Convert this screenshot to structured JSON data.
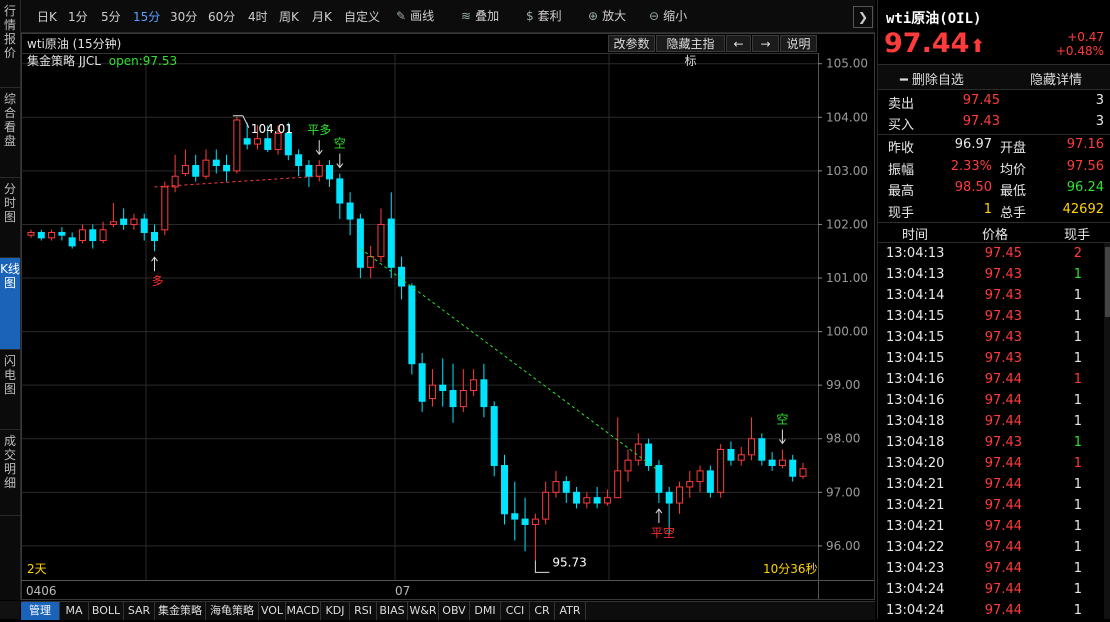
{
  "left_tabs": [
    {
      "label": "行情报价",
      "active": false
    },
    {
      "label": "综合看盘",
      "active": false
    },
    {
      "label": "分时图",
      "active": false
    },
    {
      "label": "K线图",
      "active": true
    },
    {
      "label": "闪电图",
      "active": false
    },
    {
      "label": "成交明细",
      "active": false
    }
  ],
  "toolbar": {
    "periods": [
      "日K",
      "1分",
      "5分",
      "15分",
      "30分",
      "60分",
      "4时",
      "周K",
      "月K",
      "自定义"
    ],
    "selected_period": "15分",
    "tools": [
      {
        "label": "画线",
        "icon": "pencil-icon"
      },
      {
        "label": "叠加",
        "icon": "stack-icon"
      },
      {
        "label": "套利",
        "icon": "money-bag-icon"
      },
      {
        "label": "放大",
        "icon": "zoom-in-icon"
      },
      {
        "label": "缩小",
        "icon": "zoom-out-icon"
      }
    ]
  },
  "chart": {
    "title": "wti原油 (15分钟)",
    "strategy_label": "集金策略 JJCL",
    "open_label": "open:97.53",
    "buttons": [
      "改参数",
      "隐藏主指标",
      "←",
      "→",
      "说明"
    ],
    "period_span": "2天",
    "countdown": "10分36秒",
    "date_labels": [
      "0406",
      "07"
    ],
    "hi_label": "104.01",
    "lo_label": "95.73",
    "signals": [
      {
        "text": "多",
        "color": "#ff2a2a",
        "idx": 12,
        "pos": "below"
      },
      {
        "text": "平多",
        "color": "#2fe12f",
        "idx": 28,
        "pos": "above"
      },
      {
        "text": "空",
        "color": "#2fe12f",
        "idx": 30,
        "pos": "above"
      },
      {
        "text": "平空",
        "color": "#ff2a2a",
        "idx": 61,
        "pos": "below"
      },
      {
        "text": "空",
        "color": "#2fe12f",
        "idx": 73,
        "pos": "above"
      }
    ],
    "colors": {
      "up": "#ff3b3b",
      "down": "#00e5ff",
      "text_green": "#2fe12f",
      "axis": "#9a9a9a"
    }
  },
  "chart_data": {
    "type": "candlestick",
    "y_ticks": [
      "105.00",
      "104.00",
      "103.00",
      "102.00",
      "101.00",
      "100.00",
      "99.00",
      "98.00",
      "97.00",
      "96.00"
    ],
    "ylim": [
      95.55,
      105.2
    ],
    "candles": [
      [
        101.8,
        101.85,
        101.75,
        101.9
      ],
      [
        101.85,
        101.75,
        101.7,
        101.9
      ],
      [
        101.75,
        101.85,
        101.7,
        101.9
      ],
      [
        101.85,
        101.8,
        101.7,
        101.95
      ],
      [
        101.75,
        101.6,
        101.55,
        101.85
      ],
      [
        101.7,
        101.9,
        101.65,
        102.0
      ],
      [
        101.9,
        101.7,
        101.55,
        102.0
      ],
      [
        101.7,
        101.9,
        101.65,
        102.05
      ],
      [
        102.0,
        102.05,
        101.95,
        102.4
      ],
      [
        102.1,
        102.0,
        101.9,
        102.3
      ],
      [
        102.0,
        102.1,
        101.9,
        102.2
      ],
      [
        102.1,
        101.85,
        101.7,
        102.2
      ],
      [
        101.85,
        101.7,
        101.5,
        102.0
      ],
      [
        101.9,
        102.7,
        101.8,
        102.8
      ],
      [
        102.7,
        102.9,
        102.6,
        103.3
      ],
      [
        102.95,
        103.1,
        102.9,
        103.4
      ],
      [
        103.1,
        102.9,
        102.8,
        103.3
      ],
      [
        102.9,
        103.2,
        102.85,
        103.4
      ],
      [
        103.2,
        103.1,
        102.95,
        103.4
      ],
      [
        103.1,
        103.0,
        102.8,
        103.3
      ],
      [
        103.0,
        103.95,
        102.95,
        104.01
      ],
      [
        103.6,
        103.5,
        103.4,
        103.9
      ],
      [
        103.5,
        103.6,
        103.4,
        103.85
      ],
      [
        103.6,
        103.4,
        103.35,
        103.85
      ],
      [
        103.4,
        103.7,
        103.3,
        103.85
      ],
      [
        103.7,
        103.3,
        103.2,
        103.9
      ],
      [
        103.3,
        103.1,
        102.9,
        103.4
      ],
      [
        103.1,
        102.9,
        102.7,
        103.2
      ],
      [
        102.9,
        103.1,
        102.8,
        103.2
      ],
      [
        103.1,
        102.85,
        102.7,
        103.2
      ],
      [
        102.85,
        102.4,
        102.1,
        102.95
      ],
      [
        102.4,
        102.1,
        101.8,
        102.6
      ],
      [
        102.1,
        101.2,
        101.0,
        102.2
      ],
      [
        101.2,
        101.4,
        101.0,
        101.6
      ],
      [
        101.4,
        102.0,
        101.3,
        102.3
      ],
      [
        102.1,
        101.2,
        101.0,
        102.6
      ],
      [
        101.2,
        100.85,
        100.6,
        101.4
      ],
      [
        100.85,
        99.4,
        99.2,
        100.9
      ],
      [
        99.4,
        98.7,
        98.5,
        99.6
      ],
      [
        98.75,
        99.0,
        98.6,
        99.3
      ],
      [
        99.0,
        98.9,
        98.6,
        99.5
      ],
      [
        98.9,
        98.6,
        98.3,
        99.4
      ],
      [
        98.6,
        98.9,
        98.5,
        99.3
      ],
      [
        98.9,
        99.1,
        98.8,
        99.3
      ],
      [
        99.1,
        98.6,
        98.4,
        99.4
      ],
      [
        98.6,
        97.5,
        97.3,
        98.7
      ],
      [
        97.5,
        96.6,
        96.4,
        97.7
      ],
      [
        96.6,
        96.5,
        96.1,
        97.2
      ],
      [
        96.5,
        96.4,
        95.9,
        96.9
      ],
      [
        96.4,
        96.5,
        95.73,
        96.6
      ],
      [
        96.5,
        97.0,
        96.4,
        97.2
      ],
      [
        97.0,
        97.2,
        96.9,
        97.4
      ],
      [
        97.2,
        97.0,
        96.8,
        97.3
      ],
      [
        97.0,
        96.8,
        96.7,
        97.1
      ],
      [
        96.8,
        96.9,
        96.7,
        97.0
      ],
      [
        96.9,
        96.8,
        96.7,
        97.1
      ],
      [
        96.8,
        96.9,
        96.75,
        97.05
      ],
      [
        96.9,
        97.4,
        96.9,
        98.4
      ],
      [
        97.4,
        97.6,
        97.2,
        97.8
      ],
      [
        97.6,
        97.9,
        97.5,
        98.1
      ],
      [
        97.9,
        97.5,
        97.4,
        98.0
      ],
      [
        97.5,
        97.0,
        96.8,
        97.6
      ],
      [
        97.0,
        96.8,
        96.2,
        97.1
      ],
      [
        96.8,
        97.1,
        96.6,
        97.2
      ],
      [
        97.1,
        97.2,
        96.9,
        97.4
      ],
      [
        97.2,
        97.4,
        97.0,
        97.5
      ],
      [
        97.4,
        97.0,
        96.9,
        97.5
      ],
      [
        97.0,
        97.8,
        96.9,
        97.9
      ],
      [
        97.8,
        97.6,
        97.5,
        97.95
      ],
      [
        97.6,
        97.7,
        97.5,
        97.85
      ],
      [
        97.7,
        98.0,
        97.6,
        98.4
      ],
      [
        98.0,
        97.6,
        97.5,
        98.1
      ],
      [
        97.6,
        97.5,
        97.4,
        97.75
      ],
      [
        97.5,
        97.6,
        97.45,
        97.8
      ],
      [
        97.6,
        97.3,
        97.2,
        97.7
      ],
      [
        97.3,
        97.44,
        97.25,
        97.55
      ]
    ],
    "red_dashed_line": [
      [
        12,
        102.7
      ],
      [
        28,
        102.9
      ]
    ],
    "green_dashed_line": [
      [
        32,
        101.55
      ],
      [
        61,
        97.4
      ]
    ]
  },
  "bottom_tabs": [
    "管理",
    "MA",
    "BOLL",
    "SAR",
    "集金策略",
    "海龟策略",
    "VOL",
    "MACD",
    "KDJ",
    "RSI",
    "BIAS",
    "W&R",
    "OBV",
    "DMI",
    "CCI",
    "CR",
    "ATR"
  ],
  "quote": {
    "name": "wti原油(OIL)",
    "price": "97.44",
    "change": "+0.47",
    "change_pct": "+0.48%",
    "delete_label": "删除自选",
    "hide_label": "隐藏详情",
    "sell": {
      "label": "卖出",
      "price": "97.45",
      "qty": "3"
    },
    "buy": {
      "label": "买入",
      "price": "97.43",
      "qty": "3"
    },
    "stats": [
      {
        "l1": "昨收",
        "v1": "96.97",
        "c1": "white",
        "l2": "开盘",
        "v2": "97.16",
        "c2": "red"
      },
      {
        "l1": "振幅",
        "v1": "2.33%",
        "c1": "red",
        "l2": "均价",
        "v2": "97.56",
        "c2": "red"
      },
      {
        "l1": "最高",
        "v1": "98.50",
        "c1": "red",
        "l2": "最低",
        "v2": "96.24",
        "c2": "green"
      },
      {
        "l1": "现手",
        "v1": "1",
        "c1": "yellow",
        "l2": "总手",
        "v2": "42692",
        "c2": "yellow"
      }
    ],
    "trade_headers": [
      "时间",
      "价格",
      "现手"
    ],
    "trades": [
      {
        "t": "13:04:13",
        "p": "97.45",
        "v": "2",
        "vc": "red"
      },
      {
        "t": "13:04:13",
        "p": "97.43",
        "v": "1",
        "vc": "green"
      },
      {
        "t": "13:04:14",
        "p": "97.43",
        "v": "1",
        "vc": "white"
      },
      {
        "t": "13:04:15",
        "p": "97.43",
        "v": "1",
        "vc": "white"
      },
      {
        "t": "13:04:15",
        "p": "97.43",
        "v": "1",
        "vc": "white"
      },
      {
        "t": "13:04:15",
        "p": "97.43",
        "v": "1",
        "vc": "white"
      },
      {
        "t": "13:04:16",
        "p": "97.44",
        "v": "1",
        "vc": "red"
      },
      {
        "t": "13:04:16",
        "p": "97.44",
        "v": "1",
        "vc": "white"
      },
      {
        "t": "13:04:18",
        "p": "97.44",
        "v": "1",
        "vc": "white"
      },
      {
        "t": "13:04:18",
        "p": "97.43",
        "v": "1",
        "vc": "green"
      },
      {
        "t": "13:04:20",
        "p": "97.44",
        "v": "1",
        "vc": "red"
      },
      {
        "t": "13:04:21",
        "p": "97.44",
        "v": "1",
        "vc": "white"
      },
      {
        "t": "13:04:21",
        "p": "97.44",
        "v": "1",
        "vc": "white"
      },
      {
        "t": "13:04:21",
        "p": "97.44",
        "v": "1",
        "vc": "white"
      },
      {
        "t": "13:04:22",
        "p": "97.44",
        "v": "1",
        "vc": "white"
      },
      {
        "t": "13:04:23",
        "p": "97.44",
        "v": "1",
        "vc": "white"
      },
      {
        "t": "13:04:24",
        "p": "97.44",
        "v": "1",
        "vc": "white"
      },
      {
        "t": "13:04:24",
        "p": "97.44",
        "v": "1",
        "vc": "white"
      }
    ]
  }
}
